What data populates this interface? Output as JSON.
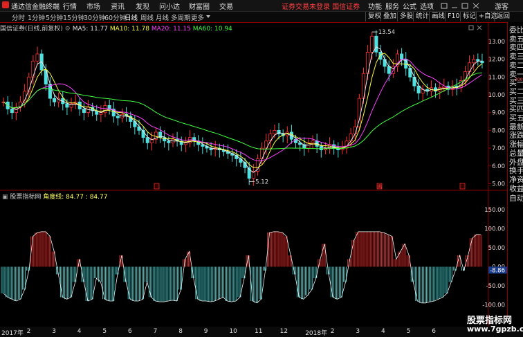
{
  "app": {
    "title": "通达信金融终端",
    "guest": "游客"
  },
  "menu": [
    "行情",
    "市场",
    "资讯",
    "发现",
    "问小达",
    "财富圈",
    "交易"
  ],
  "warning": "证券交易未登录   国信证券",
  "right_menu": [
    "功能",
    "服务",
    "公式",
    "选项"
  ],
  "periods": [
    "分时",
    "1分钟",
    "5分钟",
    "15分钟",
    "30分钟",
    "60分钟",
    "日线",
    "周线",
    "月线",
    "多周期",
    "更多"
  ],
  "active_period": "日线",
  "tools": [
    "复权",
    "叠加",
    "多股",
    "统计",
    "画线",
    "F10",
    "标记",
    "+自选",
    "返回"
  ],
  "chart_title": "国信证券(日线,前复权)",
  "ma": {
    "ma5": "MA5: 11.77",
    "ma10": "MA10: 11.78",
    "ma20": "MA20: 11.15",
    "ma60": "MA60: 10.94"
  },
  "sub": {
    "name": "股票指标网",
    "value": "角度线: 84.77 : 84.77"
  },
  "right_panel": [
    "委比",
    "卖五",
    "卖四",
    "卖三",
    "卖二",
    "卖一",
    "买一",
    "买二",
    "买三",
    "买四",
    "买五",
    "最新",
    "涨跌",
    "涨幅",
    "总量",
    "外盘",
    "换手",
    "净资",
    "收益"
  ],
  "right_panel_bottom": "自动",
  "right_panel_badge": "300",
  "annotations": {
    "high": "13.54",
    "low": "5.12",
    "current": "-8.86",
    "badge": "揭"
  },
  "x_dates": [
    "2017年",
    "2",
    "3",
    "4",
    "5",
    "6",
    "7",
    "8",
    "9",
    "10",
    "11",
    "12",
    "2018年",
    "2",
    "3",
    "4",
    "5",
    "6"
  ],
  "watermark": {
    "cn": "股票指标网",
    "url": "www.7gpzb.com"
  },
  "colors": {
    "up": "#ff3030",
    "down": "#50e0e0",
    "ma5": "#e8e8e8",
    "ma10": "#ffff40",
    "ma20": "#ff40ff",
    "ma60": "#40ff40",
    "bg": "#000000",
    "border": "#8a0000"
  },
  "chart_data": [
    {
      "type": "candlestick",
      "y_ticks": [
        "13.00",
        "12.00",
        "11.00",
        "10.00",
        "9.00",
        "8.00",
        "7.00",
        "6.00",
        "5.00"
      ],
      "ylim": [
        4.9,
        13.7
      ],
      "x_labels": [
        "2017年",
        "2",
        "3",
        "4",
        "5",
        "6",
        "7",
        "8",
        "9",
        "10",
        "11",
        "12",
        "2018年",
        "2",
        "3",
        "4",
        "5",
        "6"
      ],
      "close": [
        9.6,
        9.2,
        9.0,
        9.3,
        9.6,
        10.2,
        11.0,
        11.9,
        12.3,
        11.4,
        10.6,
        9.8,
        9.6,
        9.8,
        9.5,
        9.3,
        9.5,
        9.6,
        9.2,
        9.0,
        9.3,
        9.1,
        8.9,
        9.0,
        9.4,
        9.2,
        8.8,
        8.7,
        8.9,
        8.8,
        8.5,
        8.2,
        8.0,
        7.6,
        7.3,
        7.5,
        7.9,
        7.6,
        7.4,
        7.3,
        7.5,
        7.4,
        7.2,
        7.3,
        7.6,
        7.4,
        7.2,
        7.1,
        7.0,
        6.9,
        7.0,
        6.9,
        6.8,
        6.7,
        6.6,
        6.4,
        6.2,
        5.9,
        5.3,
        5.7,
        6.4,
        7.0,
        7.4,
        7.8,
        8.0,
        7.8,
        7.7,
        7.9,
        7.5,
        7.3,
        7.2,
        7.0,
        7.3,
        7.4,
        7.1,
        6.9,
        7.0,
        7.2,
        7.0,
        6.9,
        7.0,
        7.4,
        7.8,
        8.2,
        9.8,
        11.2,
        12.4,
        13.3,
        12.4,
        12.0,
        11.6,
        11.2,
        11.6,
        12.3,
        12.0,
        11.5,
        11.0,
        10.5,
        10.1,
        10.3,
        10.2,
        10.4,
        10.2,
        10.4,
        10.5,
        10.3,
        10.5,
        10.4,
        10.8,
        11.3,
        11.8,
        12.0,
        11.9,
        11.8
      ]
    },
    {
      "type": "bar",
      "name": "角度线",
      "y_ticks": [
        "150.00",
        "100.00",
        "50.00",
        "0.00",
        "-50.00",
        "-100.00"
      ],
      "ylim": [
        -130,
        170
      ],
      "values": [
        -70,
        -80,
        -85,
        -90,
        -85,
        -60,
        -10,
        80,
        90,
        92,
        92,
        80,
        40,
        -20,
        -80,
        -85,
        -80,
        -40,
        20,
        -40,
        -90,
        -85,
        -30,
        -40,
        -85,
        -90,
        -90,
        -20,
        30,
        -40,
        -85,
        -90,
        -90,
        -85,
        -40,
        -80,
        -90,
        -92,
        -92,
        -90,
        -88,
        -90,
        -60,
        20,
        40,
        -30,
        -85,
        -90,
        -90,
        -92,
        -90,
        -85,
        -80,
        -90,
        -92,
        -90,
        -80,
        -30,
        30,
        -90,
        -95,
        -85,
        -10,
        90,
        92,
        92,
        90,
        80,
        30,
        -20,
        -80,
        -85,
        -75,
        -60,
        -30,
        20,
        60,
        -20,
        -80,
        -85,
        -80,
        -40,
        20,
        70,
        92,
        92,
        92,
        92,
        92,
        92,
        90,
        85,
        80,
        20,
        40,
        60,
        30,
        -40,
        -90,
        -95,
        -95,
        -92,
        -90,
        -85,
        -80,
        -70,
        -40,
        -10,
        30,
        -10,
        30,
        75,
        85,
        84.77
      ]
    }
  ]
}
